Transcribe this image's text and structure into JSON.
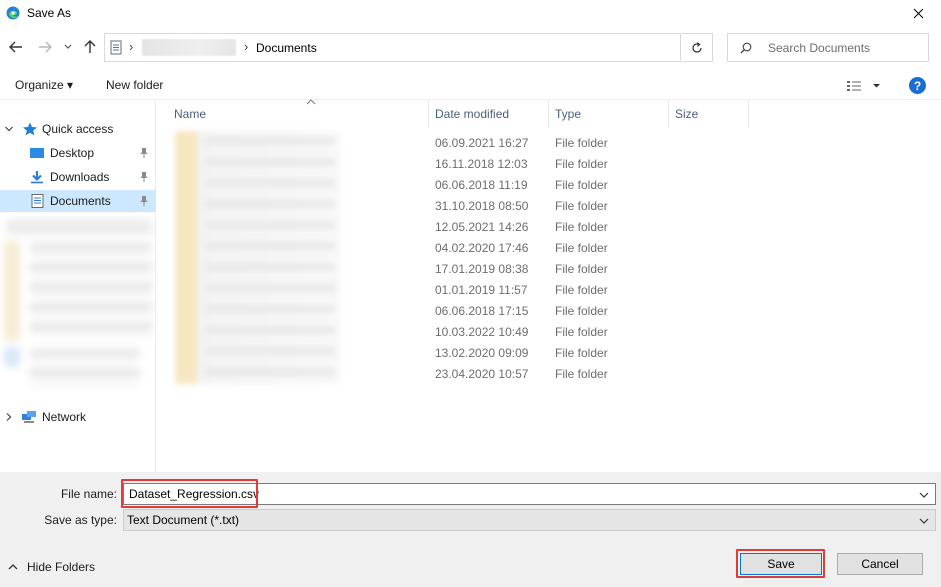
{
  "window": {
    "title": "Save As"
  },
  "navigation": {
    "breadcrumb_current": "Documents",
    "breadcrumb_separator": "›",
    "search_placeholder": "Search Documents"
  },
  "toolbar": {
    "organize_label": "Organize ▾",
    "new_folder_label": "New folder",
    "help_label": "?"
  },
  "sidebar": {
    "quick_access_label": "Quick access",
    "items": [
      {
        "label": "Desktop",
        "icon": "desktop-icon",
        "pinned": true
      },
      {
        "label": "Downloads",
        "icon": "downloads-icon",
        "pinned": true
      },
      {
        "label": "Documents",
        "icon": "documents-icon",
        "pinned": true,
        "selected": true
      }
    ],
    "network_label": "Network"
  },
  "file_list": {
    "columns": [
      "Name",
      "Date modified",
      "Type",
      "Size"
    ],
    "rows": [
      {
        "date": "06.09.2021 16:27",
        "type": "File folder"
      },
      {
        "date": "16.11.2018 12:03",
        "type": "File folder"
      },
      {
        "date": "06.06.2018 11:19",
        "type": "File folder"
      },
      {
        "date": "31.10.2018 08:50",
        "type": "File folder"
      },
      {
        "date": "12.05.2021 14:26",
        "type": "File folder"
      },
      {
        "date": "04.02.2020 17:46",
        "type": "File folder"
      },
      {
        "date": "17.01.2019 08:38",
        "type": "File folder"
      },
      {
        "date": "01.01.2019 11:57",
        "type": "File folder"
      },
      {
        "date": "06.06.2018 17:15",
        "type": "File folder"
      },
      {
        "date": "10.03.2022 10:49",
        "type": "File folder"
      },
      {
        "date": "13.02.2020 09:09",
        "type": "File folder"
      },
      {
        "date": "23.04.2020 10:57",
        "type": "File folder"
      }
    ]
  },
  "form": {
    "file_name_label": "File name:",
    "file_name_value": "Dataset_Regression.csv",
    "save_as_type_label": "Save as type:",
    "save_as_type_value": "Text Document (*.txt)"
  },
  "footer": {
    "hide_folders_label": "Hide Folders",
    "save_label": "Save",
    "cancel_label": "Cancel"
  },
  "colors": {
    "accent": "#0078d7",
    "selection": "#cce8ff",
    "highlight_box": "#e03a3a",
    "help_icon": "#1a6dd1"
  }
}
